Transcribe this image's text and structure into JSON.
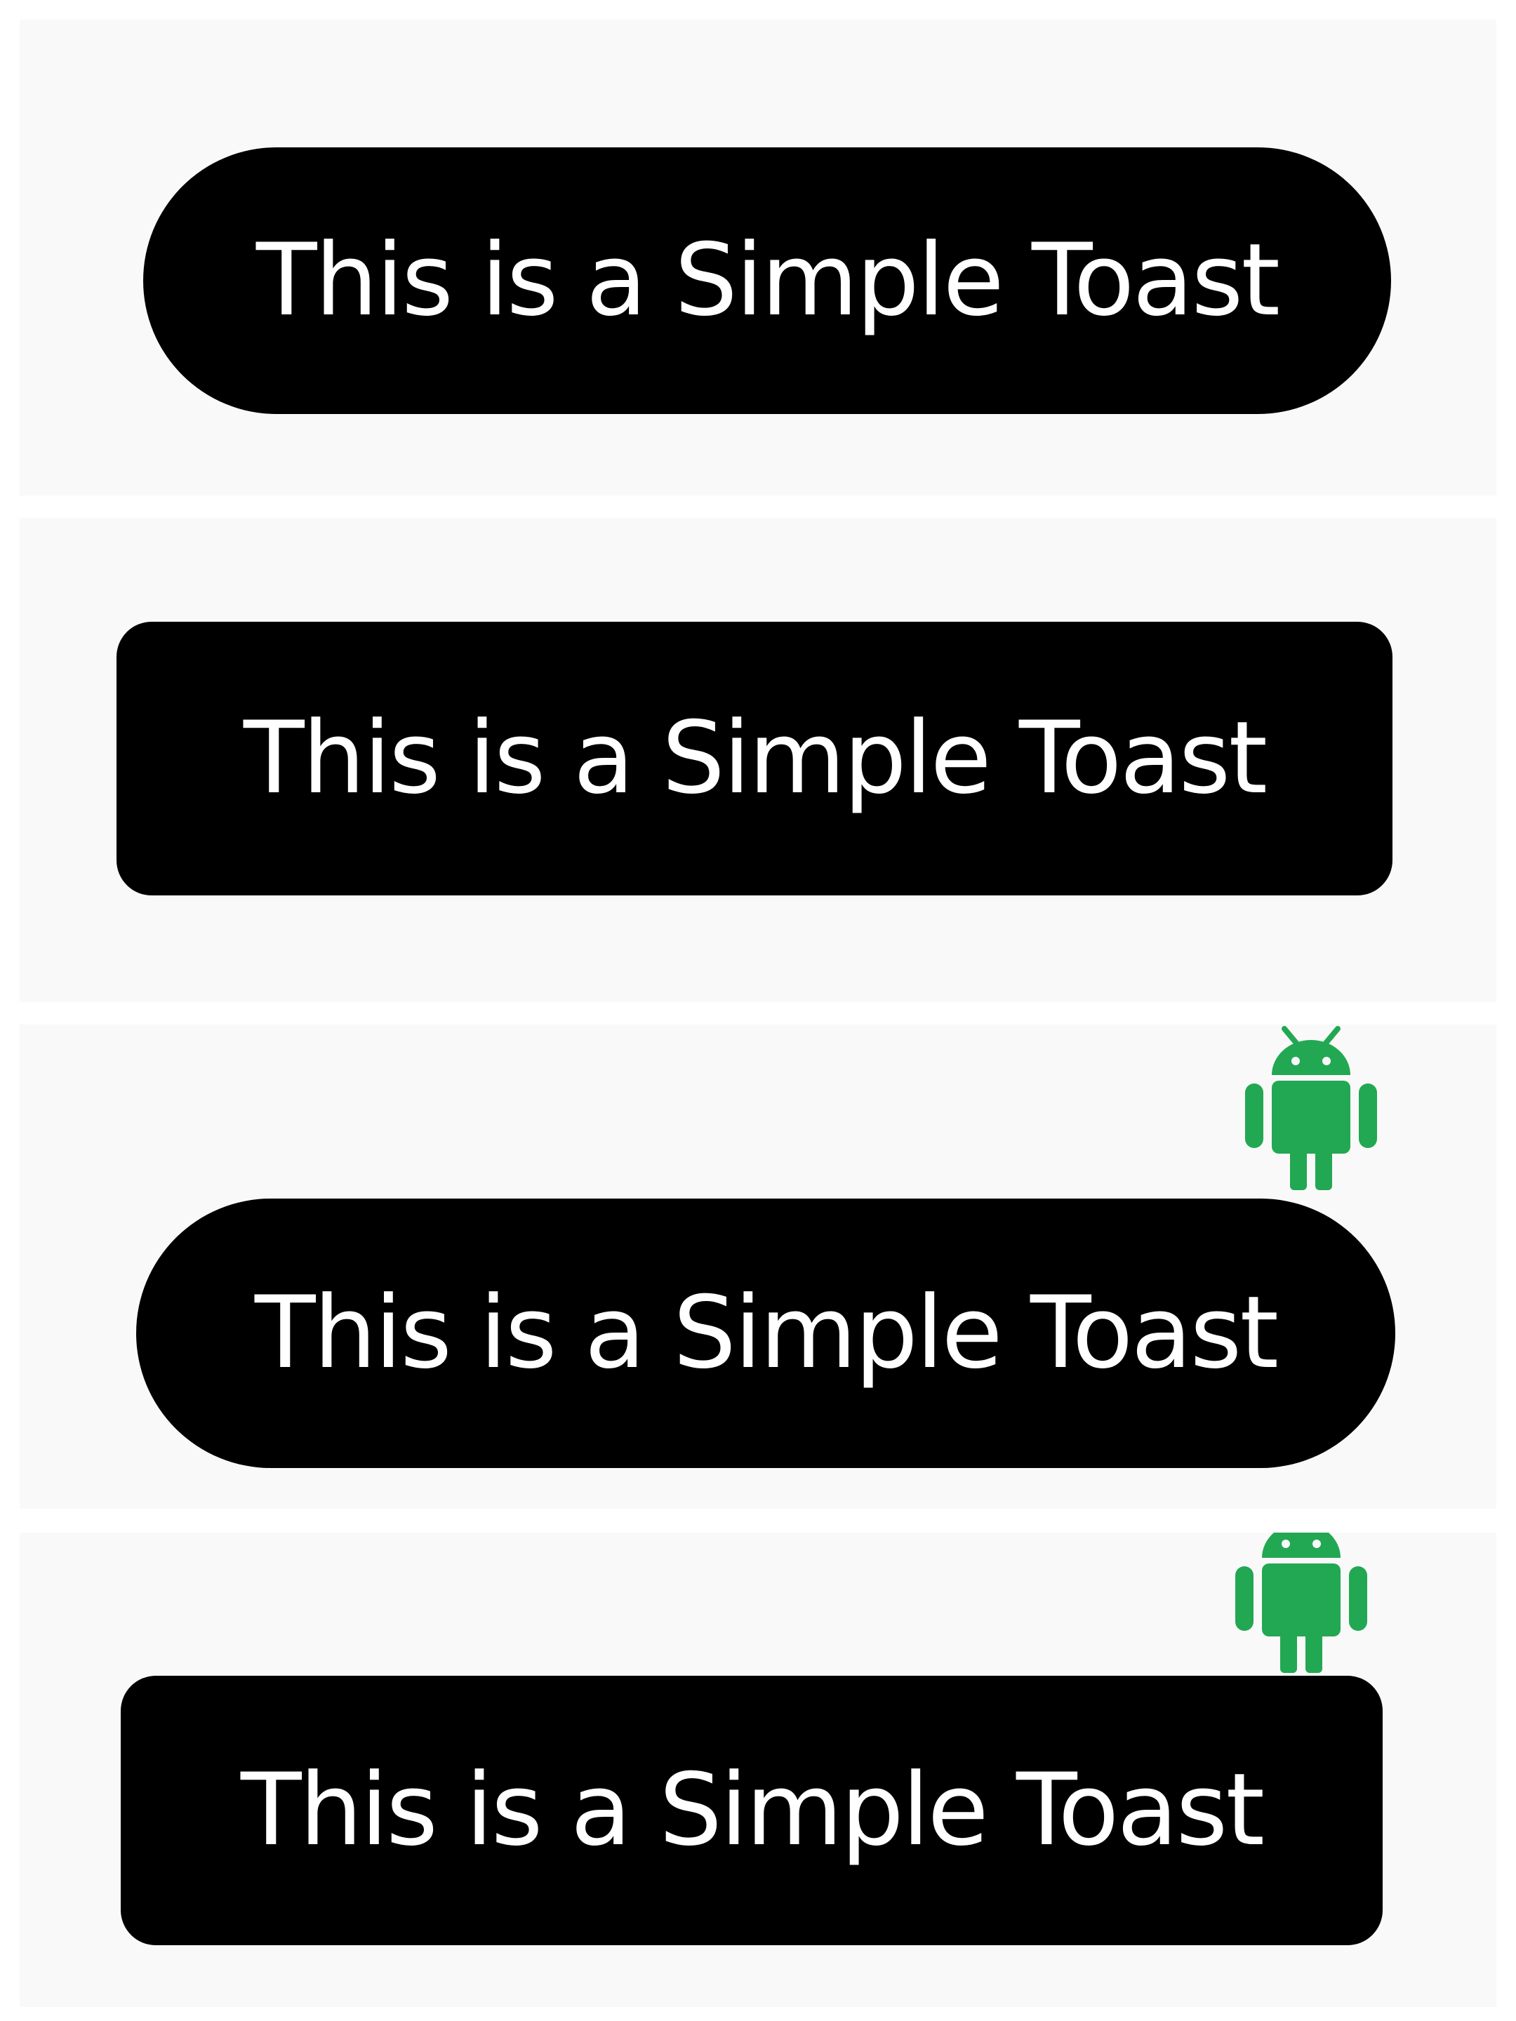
{
  "toasts": [
    {
      "message": "This is a Simple Toast",
      "shape": "pill",
      "has_icon": false
    },
    {
      "message": "This is a Simple Toast",
      "shape": "rounded-rectangle",
      "has_icon": false
    },
    {
      "message": "This is a Simple Toast",
      "shape": "pill",
      "has_icon": true,
      "icon": "android-robot-icon"
    },
    {
      "message": "This is a Simple Toast",
      "shape": "rounded-rectangle",
      "has_icon": true,
      "icon": "android-robot-icon"
    }
  ],
  "colors": {
    "panel_background": "#f9f9f9",
    "toast_background": "#000000",
    "toast_text": "#ffffff",
    "android_green": "#22a852"
  }
}
